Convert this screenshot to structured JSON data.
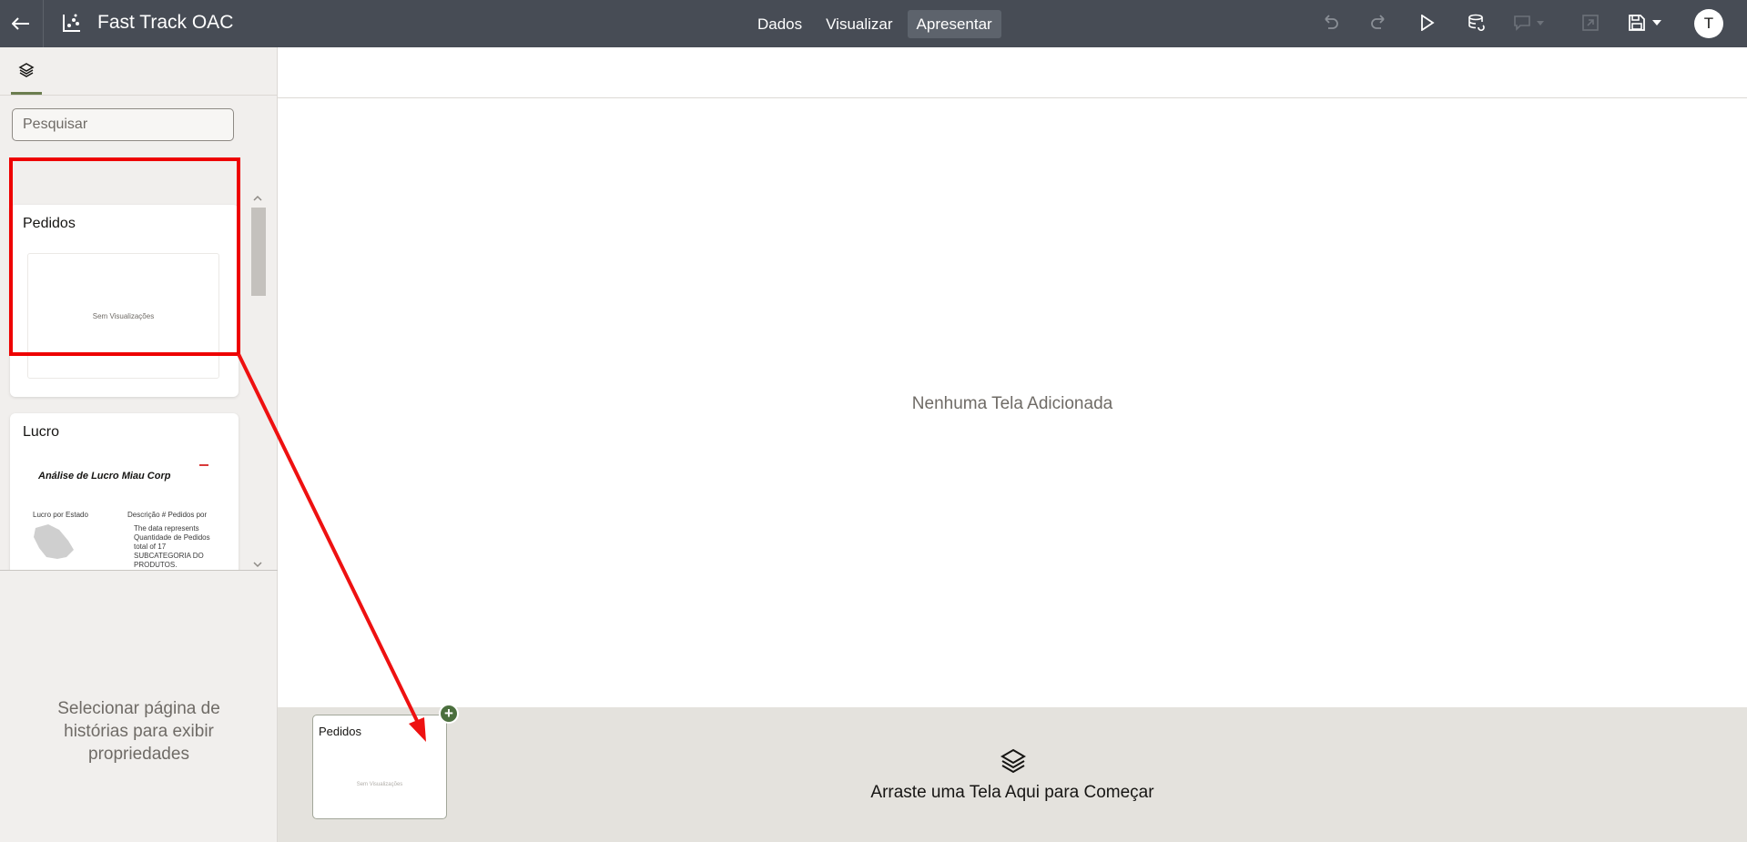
{
  "header": {
    "title": "Fast Track OAC",
    "tabs": [
      {
        "label": "Dados",
        "active": false
      },
      {
        "label": "Visualizar",
        "active": false
      },
      {
        "label": "Apresentar",
        "active": true
      }
    ],
    "toolbar_icons": [
      "undo-icon",
      "redo-icon",
      "play-icon",
      "data-refresh-icon",
      "comment-icon",
      "export-icon",
      "save-icon"
    ],
    "avatar": "T"
  },
  "left_panel": {
    "tab_icon": "layers-icon",
    "search": {
      "placeholder": "Pesquisar",
      "value": ""
    },
    "cards": [
      {
        "title": "Pedidos",
        "thumbnail_text": "Sem Visualizações",
        "highlighted": true
      },
      {
        "title": "Lucro",
        "thumbnail": {
          "heading": "Análise de Lucro Miau Corp",
          "left_label": "Lucro por Estado",
          "right_label": "Descrição # Pedidos por",
          "description": "The data represents Quantidade de Pedidos total of 17 SUBCATEGORIA DO PRODUTOS."
        }
      }
    ],
    "properties_hint": "Selecionar página de histórias para exibir propriedades"
  },
  "canvas": {
    "empty_text": "Nenhuma Tela Adicionada"
  },
  "bottom_strip": {
    "drop_text": "Arraste uma Tela Aqui para Começar",
    "drag_card": {
      "title": "Pedidos",
      "thumbnail_text": "Sem Visualizações"
    }
  },
  "colors": {
    "topbar": "#474c55",
    "highlight": "#ee0000",
    "accent_green": "#4b6f3e"
  }
}
